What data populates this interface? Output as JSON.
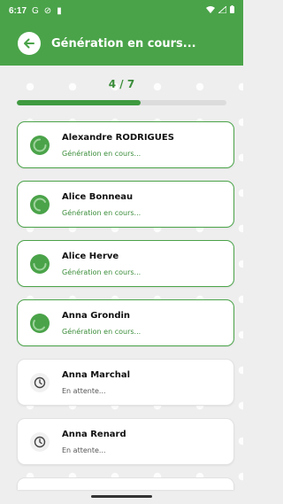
{
  "status_bar": {
    "time": "6:17",
    "icons": [
      "google-icon",
      "do-not-disturb-icon",
      "sim-icon",
      "wifi-icon",
      "signal-icon",
      "battery-icon"
    ]
  },
  "app_bar": {
    "title": "Génération en cours..."
  },
  "progress": {
    "label": "4 / 7",
    "fraction": 0.59
  },
  "colors": {
    "primary": "#4aa349",
    "progress_fill": "#3f9a40",
    "waiting_text": "#555555"
  },
  "items": [
    {
      "name": "Alexandre RODRIGUES",
      "status": "Génération en cours...",
      "state": "in-progress"
    },
    {
      "name": "Alice Bonneau",
      "status": "Génération en cours...",
      "state": "in-progress"
    },
    {
      "name": "Alice Herve",
      "status": "Génération en cours...",
      "state": "in-progress"
    },
    {
      "name": "Anna Grondin",
      "status": "Génération en cours...",
      "state": "in-progress"
    },
    {
      "name": "Anna Marchal",
      "status": "En attente...",
      "state": "waiting"
    },
    {
      "name": "Anna Renard",
      "status": "En attente...",
      "state": "waiting"
    }
  ]
}
